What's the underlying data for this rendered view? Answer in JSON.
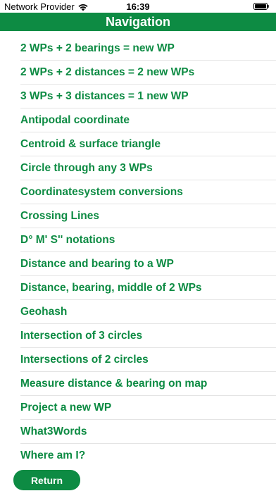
{
  "status_bar": {
    "carrier": "Network Provider",
    "time": "16:39",
    "wifi_icon": "wifi-icon",
    "battery_icon": "battery-icon"
  },
  "nav": {
    "title": "Navigation"
  },
  "menu": {
    "items": [
      {
        "label": "2 WPs + 2 bearings = new WP"
      },
      {
        "label": "2 WPs + 2 distances = 2 new WPs"
      },
      {
        "label": "3 WPs + 3 distances = 1 new WP"
      },
      {
        "label": "Antipodal coordinate"
      },
      {
        "label": "Centroid & surface triangle"
      },
      {
        "label": "Circle through any 3 WPs"
      },
      {
        "label": "Coordinatesystem conversions"
      },
      {
        "label": "Crossing Lines"
      },
      {
        "label": "D° M' S'' notations"
      },
      {
        "label": "Distance and bearing to a WP"
      },
      {
        "label": "Distance, bearing, middle of 2 WPs"
      },
      {
        "label": "Geohash"
      },
      {
        "label": "Intersection of 3 circles"
      },
      {
        "label": "Intersections of 2 circles"
      },
      {
        "label": "Measure distance & bearing on map"
      },
      {
        "label": "Project a new WP"
      },
      {
        "label": "What3Words"
      },
      {
        "label": "Where am I?"
      }
    ]
  },
  "footer": {
    "return_label": "Return"
  },
  "colors": {
    "accent": "#0d8b43",
    "separator": "#e4e4e4",
    "background": "#ffffff"
  }
}
